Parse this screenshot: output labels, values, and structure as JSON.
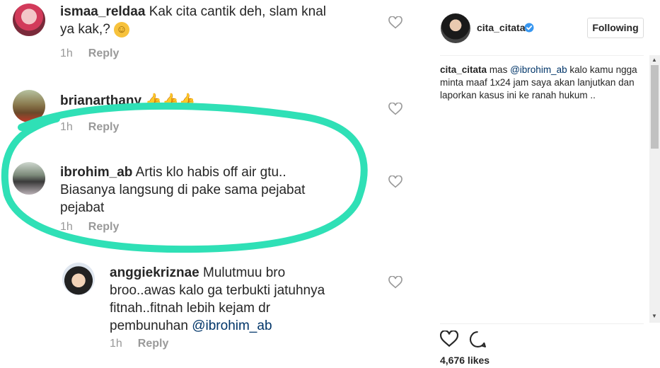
{
  "comments": [
    {
      "username": "ismaa_reldaa",
      "text_line1": "Kak cita cantik deh, slam knal",
      "text_line2": "ya kak,?",
      "emoji": "☺",
      "time": "1h",
      "reply": "Reply"
    },
    {
      "username": "brianarthany",
      "text": "👍👍👍",
      "time": "1h",
      "reply": "Reply"
    },
    {
      "username": "ibrohim_ab",
      "text_line1": "Artis klo habis off air gtu..",
      "text_line2": "Biasanya langsung di pake sama pejabat",
      "text_line3": "pejabat",
      "time": "1h",
      "reply": "Reply"
    },
    {
      "username": "anggiekriznae",
      "text_line1": "Mulutmuu bro",
      "text_line2": "broo..awas kalo ga terbukti jatuhnya",
      "text_line3": "fitnah..fitnah lebih kejam dr",
      "text_line4_pre": "pembunuhan",
      "mention": "@ibrohim_ab",
      "time": "1h",
      "reply": "Reply"
    }
  ],
  "post": {
    "username": "cita_citata",
    "follow_button": "Following",
    "caption_user": "cita_citata",
    "caption_pre": "mas",
    "caption_mention": "@ibrohim_ab",
    "caption_rest": "kalo kamu ngga minta maaf 1x24 jam saya akan lanjutkan dan laporkan kasus ini ke ranah hukum ..",
    "likes": "4,676 likes"
  },
  "colors": {
    "highlight": "#2fe0b6",
    "verified": "#3897f0",
    "mention": "#003569"
  }
}
